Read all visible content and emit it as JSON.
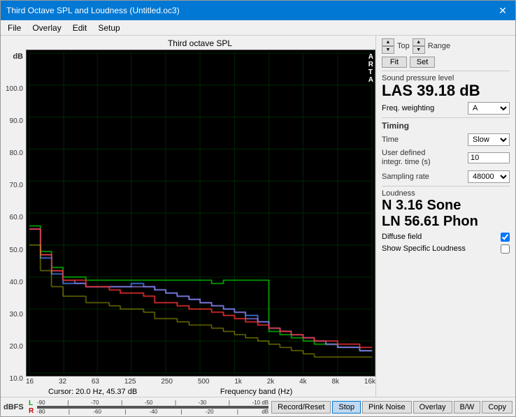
{
  "window": {
    "title": "Third Octave SPL and Loudness (Untitled.oc3)"
  },
  "menu": {
    "items": [
      "File",
      "Overlay",
      "Edit",
      "Setup"
    ]
  },
  "chart": {
    "title": "Third octave SPL",
    "y_axis_label": "dB",
    "y_ticks": [
      "100.0",
      "90.0",
      "80.0",
      "70.0",
      "60.0",
      "50.0",
      "40.0",
      "30.0",
      "20.0",
      "10.0"
    ],
    "x_ticks": [
      "16",
      "32",
      "63",
      "125",
      "250",
      "500",
      "1k",
      "2k",
      "4k",
      "8k",
      "16k"
    ],
    "cursor_info": "Cursor:  20.0 Hz, 45.37 dB",
    "freq_band_label": "Frequency band (Hz)",
    "arta_label": "A\nR\nT\nA"
  },
  "right_panel": {
    "top_label": "Top",
    "range_label": "Range",
    "fit_label": "Fit",
    "set_label": "Set",
    "spl_section_title": "Sound pressure level",
    "spl_value": "LAS 39.18 dB",
    "freq_weighting_label": "Freq. weighting",
    "freq_weighting_value": "A",
    "timing_title": "Timing",
    "time_label": "Time",
    "time_value": "Slow",
    "user_defined_label": "User defined\nintegr. time (s)",
    "user_defined_value": "10",
    "sampling_rate_label": "Sampling rate",
    "sampling_rate_value": "48000",
    "loudness_title": "Loudness",
    "loudness_value1": "N 3.16 Sone",
    "loudness_value2": "LN 56.61 Phon",
    "diffuse_field_label": "Diffuse field",
    "show_specific_loudness_label": "Show Specific Loudness",
    "diffuse_field_checked": true,
    "show_specific_loudness_checked": false
  },
  "bottom": {
    "dbfs_label": "dBFS",
    "l_label": "L",
    "r_label": "R",
    "ticks_top": [
      "-90",
      "-70",
      "-50",
      "-30",
      "-10 dB"
    ],
    "ticks_bot": [
      "-80",
      "-60",
      "-40",
      "-20",
      "dB"
    ],
    "buttons": [
      "Record/Reset",
      "Stop",
      "Pink Noise",
      "Overlay",
      "B/W",
      "Copy"
    ]
  }
}
